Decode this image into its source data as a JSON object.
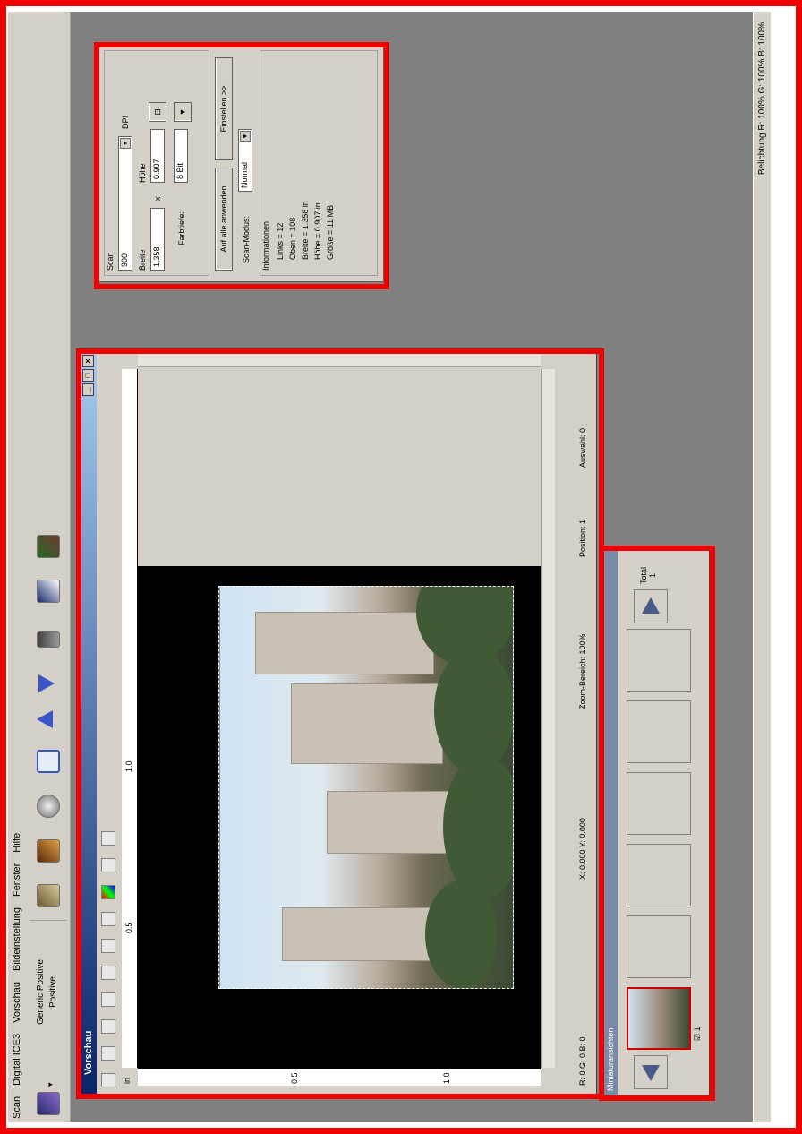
{
  "menu": [
    "Scan",
    "Digital ICE3",
    "Vorschau",
    "Bildeinstellung",
    "Fenster",
    "Hilfe"
  ],
  "toolbar": {
    "source_title": "Generic Positive",
    "source_sub": "Positive",
    "icons": [
      "scanner-icon",
      "eye-icon",
      "filmstrip-icon",
      "lens-icon",
      "zoom-icon",
      "arrow-up-icon",
      "arrow-down-icon",
      "phone-icon",
      "document-icon",
      "settings-icon"
    ]
  },
  "status": {
    "exposure": "Belichtung R: 100%  G: 100%  B: 100%"
  },
  "scan_panel": {
    "title": "Scan",
    "resolution": "900",
    "unit": "DPI",
    "width_label": "Breite",
    "height_label": "Höhe",
    "width_value": "1.358",
    "times": "x",
    "height_value": "0.907",
    "depth_label": "Farbtiefe:",
    "depth_value": "8 Bit",
    "apply_all": "Auf alle anwenden",
    "unit_btn": "Einstellen >>",
    "mode_label": "Scan-Modus:",
    "mode_value": "Normal",
    "info_title": "Informationen",
    "info": [
      "Links =  12",
      "Oben =  108",
      "Breite =  1.358 in",
      "Höhe =  0.907 in",
      "Größe =  11 MB"
    ]
  },
  "preview": {
    "title": "Vorschau",
    "unit": "in",
    "ruler_h": [
      "0.5",
      "1.0"
    ],
    "ruler_v": [
      "0.5",
      "1.0"
    ],
    "status_rgb": "R: 0   G: 0   B: 0",
    "status_xy": "X: 0.000   Y: 0.000",
    "status_zoom": "Zoom-Bereich:  100%",
    "status_pos": "Position:   1",
    "status_sel": "Auswahl:  0"
  },
  "filmstrip": {
    "title": "Miniaturansichten",
    "check_label": "1",
    "total_label": "Total",
    "total_value": "1"
  }
}
